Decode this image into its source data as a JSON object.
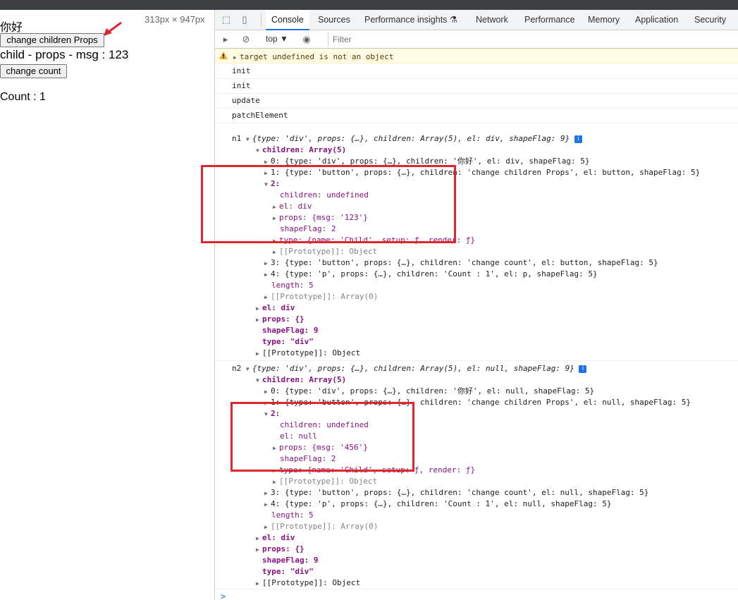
{
  "viewport": {
    "dims": "313px × 947px",
    "hello_text": "你好",
    "change_props_button": "change children Props",
    "child_msg": "child - props - msg : 123",
    "change_count_button": "change count",
    "count_text": "Count : 1"
  },
  "devtools": {
    "tabs": [
      "Console",
      "Sources",
      "Performance insights",
      "Network",
      "Performance",
      "Memory",
      "Application",
      "Security"
    ],
    "active_tab": "Console",
    "context": "top ▼",
    "filter_placeholder": "Filter",
    "warning": "target undefined is not an object",
    "messages": [
      "init",
      "init",
      "update",
      "patchElement"
    ]
  },
  "n1": {
    "label": "n1",
    "summary": "{type: 'div', props: {…}, children: Array(5), el: div, shapeFlag: 9}",
    "children_label": "children: Array(5)",
    "c0": "0: {type: 'div', props: {…}, children: '你好', el: div, shapeFlag: 5}",
    "c1": "1: {type: 'button', props: {…}, children: 'change children Props', el: button, shapeFlag: 5}",
    "c2": "2:",
    "c2_children": "children: undefined",
    "c2_el": "el: div",
    "c2_props": "props: {msg: '123'}",
    "c2_shapeflag": "shapeFlag: 2",
    "c2_type": "type: {name: 'Child', setup: ƒ, render: ƒ}",
    "c2_proto": "[[Prototype]]: Object",
    "c3": "3: {type: 'button', props: {…}, children: 'change count', el: button, shapeFlag: 5}",
    "c4": "4: {type: 'p', props: {…}, children: 'Count : 1', el: p, shapeFlag: 5}",
    "length": "length: 5",
    "arr_proto": "[[Prototype]]: Array(0)",
    "el": "el: div",
    "props": "props: {}",
    "shapeflag": "shapeFlag: 9",
    "type": "type: \"div\"",
    "proto": "[[Prototype]]: Object"
  },
  "n2": {
    "label": "n2",
    "summary": "{type: 'div', props: {…}, children: Array(5), el: null, shapeFlag: 9}",
    "children_label": "children: Array(5)",
    "c0": "0: {type: 'div', props: {…}, children: '你好', el: null, shapeFlag: 5}",
    "c1": "1: {type: 'button', props: {…}, children: 'change children Props', el: null, shapeFlag: 5}",
    "c2": "2:",
    "c2_children": "children: undefined",
    "c2_el": "el: null",
    "c2_props": "props: {msg: '456'}",
    "c2_shapeflag": "shapeFlag: 2",
    "c2_type": "type: {name: 'Child', setup: ƒ, render: ƒ}",
    "c2_proto": "[[Prototype]]: Object",
    "c3": "3: {type: 'button', props: {…}, children: 'change count', el: null, shapeFlag: 5}",
    "c4": "4: {type: 'p', props: {…}, children: 'Count : 1', el: null, shapeFlag: 5}",
    "length": "length: 5",
    "arr_proto": "[[Prototype]]: Array(0)",
    "el": "el: div",
    "props": "props: {}",
    "shapeflag": "shapeFlag: 9",
    "type": "type: \"div\"",
    "proto": "[[Prototype]]: Object"
  },
  "prompt": ">",
  "colors": {
    "highlight": "#e0262f",
    "accent": "#1a73e8",
    "warning_bg": "#fffbe5"
  }
}
